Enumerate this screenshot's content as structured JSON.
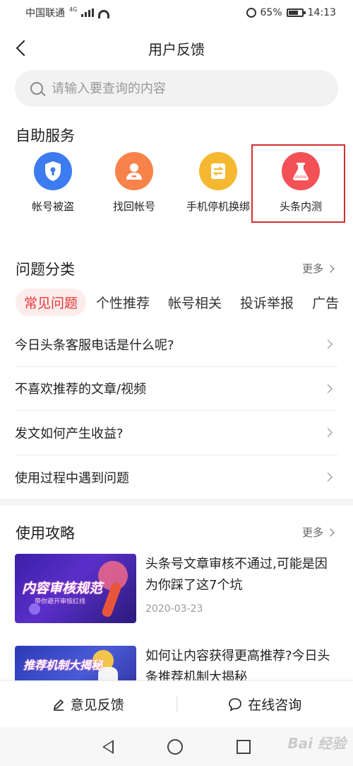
{
  "status_bar": {
    "carrier": "中国联通",
    "network": "4G",
    "battery": "65%",
    "time": "14:13"
  },
  "nav": {
    "title": "用户反馈"
  },
  "search": {
    "placeholder": "请输入要查询的内容"
  },
  "self_service": {
    "title": "自助服务",
    "items": [
      {
        "label": "帐号被盗",
        "icon": "shield-lock-icon",
        "color": "#3d7cf0"
      },
      {
        "label": "找回帐号",
        "icon": "user-icon",
        "color": "#f7834a"
      },
      {
        "label": "手机停机换绑",
        "icon": "swap-icon",
        "color": "#f5b830"
      },
      {
        "label": "头条内测",
        "icon": "flask-icon",
        "color": "#f25156"
      }
    ]
  },
  "categories": {
    "title": "问题分类",
    "more": "更多",
    "tabs": [
      "常见问题",
      "个性推荐",
      "帐号相关",
      "投诉举报",
      "广告"
    ],
    "faqs": [
      "今日头条客服电话是什么呢?",
      "不喜欢推荐的文章/视频",
      "发文如何产生收益?",
      "使用过程中遇到问题"
    ]
  },
  "guides": {
    "title": "使用攻略",
    "more": "更多",
    "items": [
      {
        "title": "头条号文章审核不通过,可能是因为你踩了这7个坑",
        "date": "2020-03-23",
        "thumb_text": "内容审核规范",
        "thumb_sub": "带你避开审核红线"
      },
      {
        "title": "如何让内容获得更高推荐?今日头条推荐机制大揭秘",
        "thumb_text": "推荐机制大揭秘"
      }
    ]
  },
  "bottom": {
    "feedback": "意见反馈",
    "consult": "在线咨询"
  },
  "watermark": "Bai 经验"
}
